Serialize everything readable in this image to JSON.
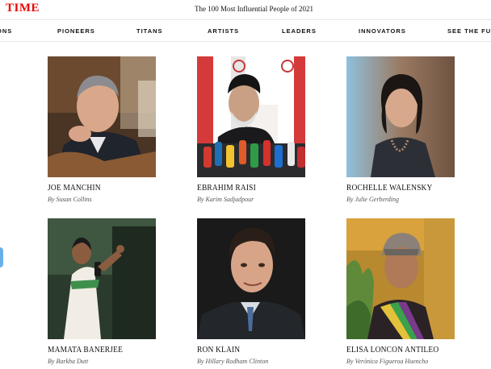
{
  "header": {
    "logo": "TIME",
    "title": "The 100 Most Influential People of 2021",
    "brand_color": "#e90606"
  },
  "nav": {
    "items": [
      {
        "label": "ONS"
      },
      {
        "label": "PIONEERS"
      },
      {
        "label": "TITANS"
      },
      {
        "label": "ARTISTS"
      },
      {
        "label": "LEADERS"
      },
      {
        "label": "INNOVATORS"
      },
      {
        "label": "SEE THE FULL"
      }
    ]
  },
  "profiles": [
    {
      "name": "JOE MANCHIN",
      "byline": "By Susan Collins",
      "icon": "portrait-photo"
    },
    {
      "name": "EBRAHIM RAISI",
      "byline": "By Karim Sadjadpour",
      "icon": "portrait-photo"
    },
    {
      "name": "ROCHELLE WALENSKY",
      "byline": "By Julie Gerberding",
      "icon": "portrait-photo"
    },
    {
      "name": "MAMATA BANERJEE",
      "byline": "By Barkha Dutt",
      "icon": "portrait-photo"
    },
    {
      "name": "RON KLAIN",
      "byline": "By Hillary Rodham Clinton",
      "icon": "portrait-photo"
    },
    {
      "name": "ELISA LONCON ANTILEO",
      "byline": "By Verónica Figueroa Huencho",
      "icon": "portrait-photo"
    }
  ]
}
